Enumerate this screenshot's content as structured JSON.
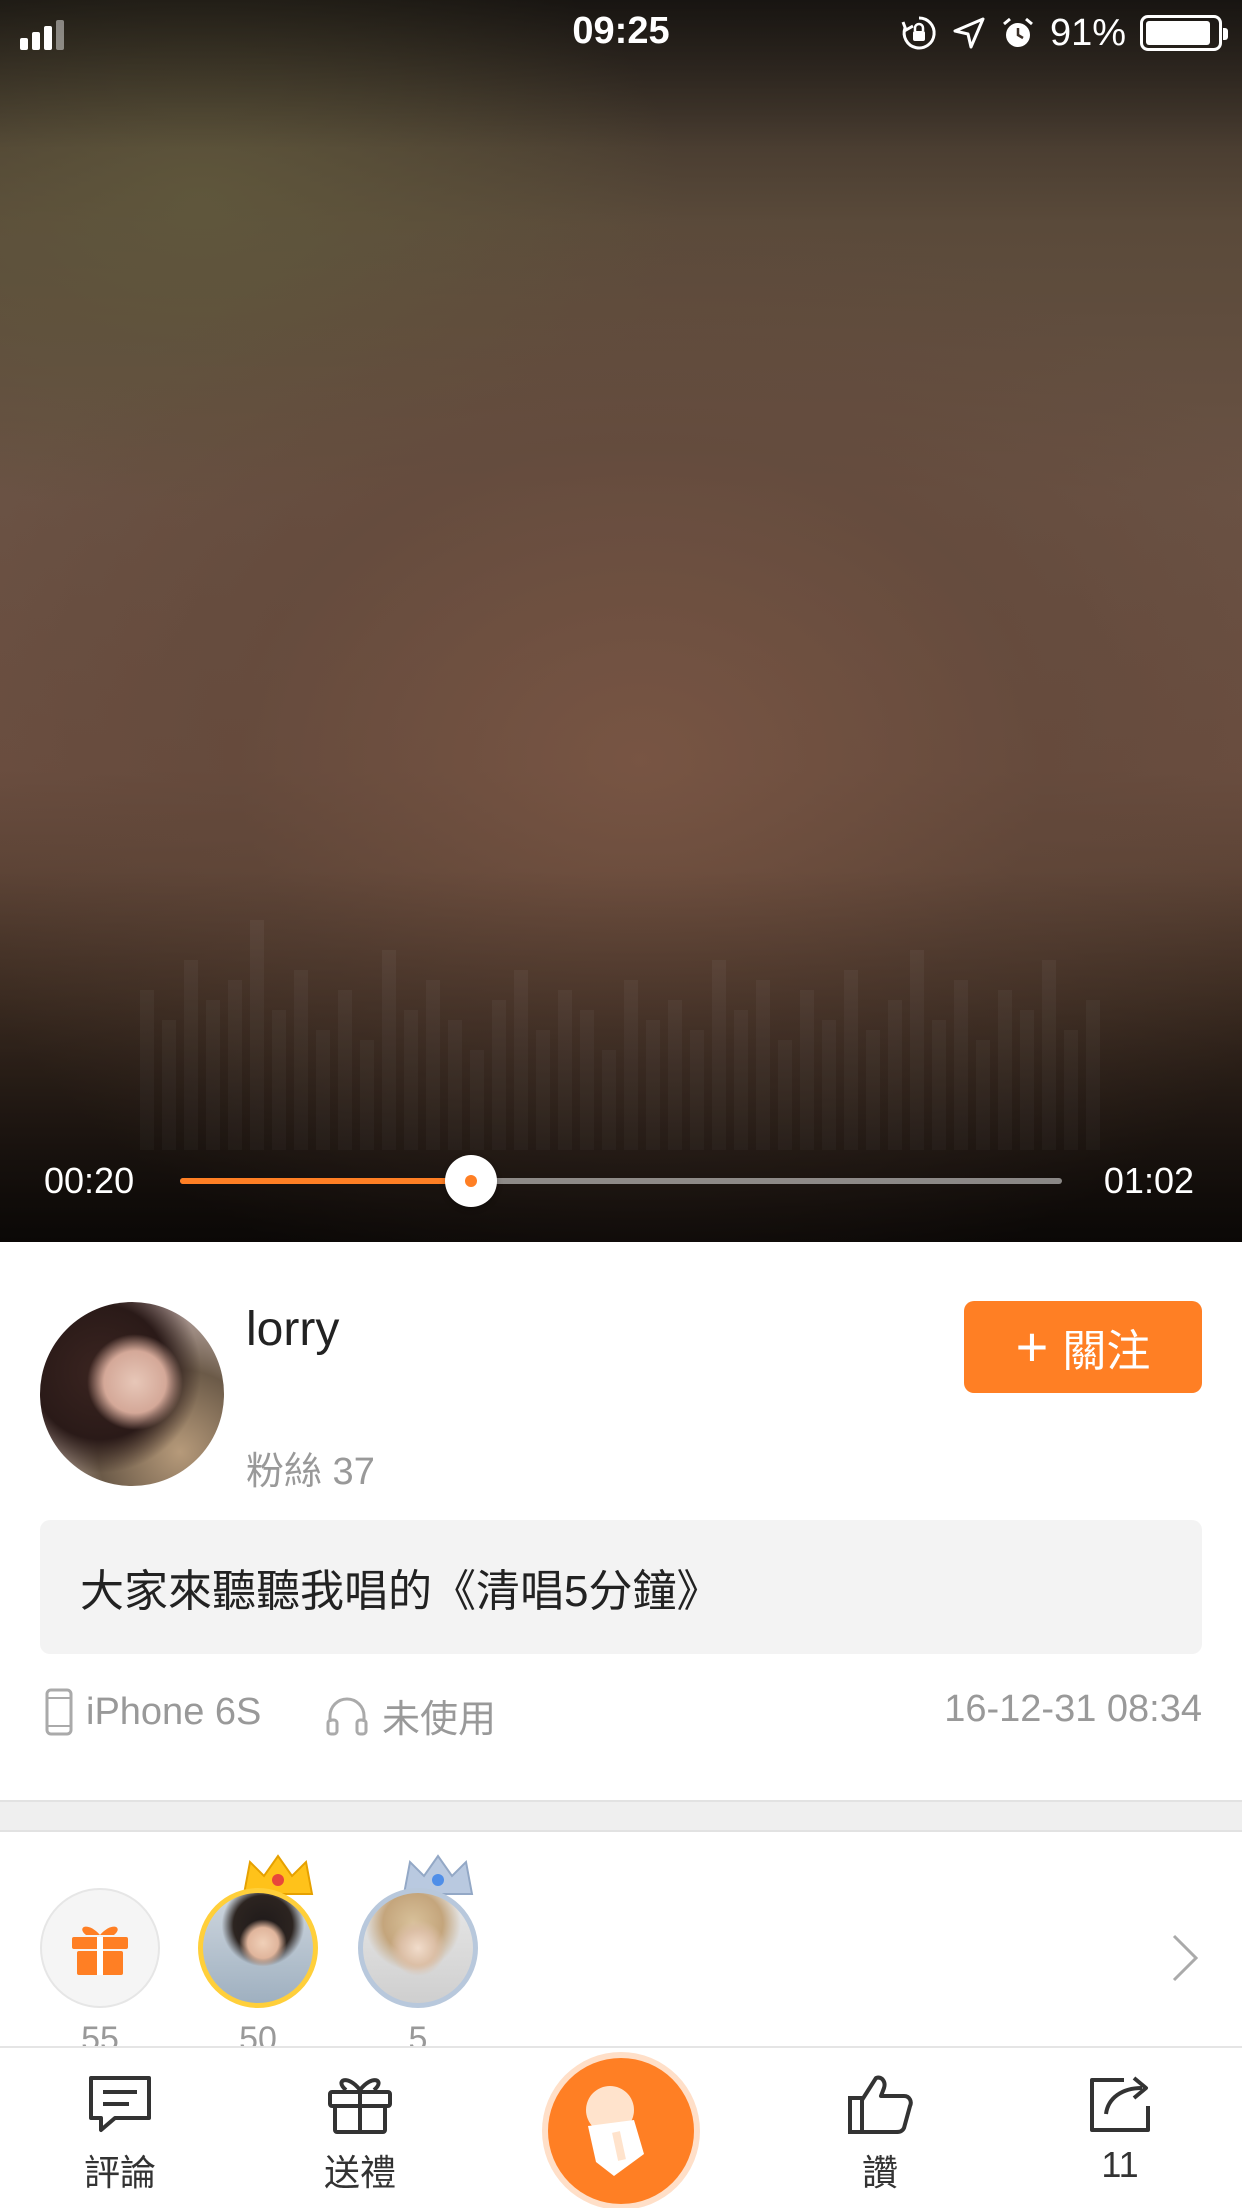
{
  "status_bar": {
    "time": "09:25",
    "battery": "91%",
    "battery_level": 0.91,
    "icons": [
      "signal-icon",
      "rotation-lock-icon",
      "location-icon",
      "alarm-icon",
      "battery-icon"
    ]
  },
  "player": {
    "current_time": "00:20",
    "total_time": "01:02",
    "progress": 0.33,
    "accent_color": "#ff7f24"
  },
  "profile": {
    "username": "lorry",
    "fans": "粉絲 37",
    "follow_label": "關注",
    "follow_icon": "plus-icon"
  },
  "post": {
    "description": "大家來聽聽我唱的《清唱5分鐘》",
    "device": "iPhone 6S",
    "headset": "未使用",
    "date": "16-12-31 08:34"
  },
  "gifts": {
    "counts": [
      "55",
      "50",
      "5"
    ]
  },
  "bottom_bar": {
    "comment_label": "評論",
    "gift_label": "送禮",
    "like_label": "讚",
    "share_count": "11"
  }
}
